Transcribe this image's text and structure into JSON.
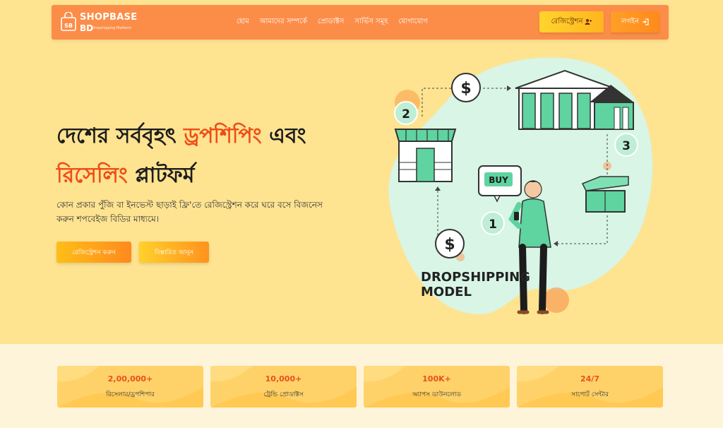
{
  "brand": {
    "name_line1": "SHOPBASE",
    "name_line2": "BD",
    "tagline": "Dropshipping Platform"
  },
  "nav": {
    "items": [
      "হোম",
      "আমাদের সম্পর্কে",
      "প্রোডাক্টস",
      "সার্ভিস সমূহ",
      "যোগাযোগ"
    ]
  },
  "header_actions": {
    "register_label": "রেজিস্ট্রেশন",
    "login_label": "লগইন"
  },
  "hero": {
    "headline_part1": "দেশের সর্ববৃহৎ ",
    "headline_accent1": "ড্রপশিপিং",
    "headline_part2": " এবং ",
    "headline_accent2": "রিসেলিং",
    "headline_part3": " প্লাটফর্ম",
    "subtext": "কোন প্রকার পুঁজি বা ইনভেস্ট ছাড়াই ফ্রি'তে রেজিস্ট্রেশন করে ঘরে বসে বিজনেস করুন শপবেইজ বিডির মাধ্যমে।",
    "cta_register": "রেজিস্ট্রেশন করুন",
    "cta_details": "বিস্তারিত জানুন"
  },
  "illustration": {
    "title_line1": "DROPSHIPPING",
    "title_line2": "MODEL",
    "buy_label": "BUY",
    "steps": [
      "1",
      "2",
      "3"
    ],
    "currency_symbol": "$"
  },
  "stats": [
    {
      "value": "2,00,000+",
      "label": "রিসেলার/ড্রপশিপার"
    },
    {
      "value": "10,000+",
      "label": "ট্রেন্ডি প্রোডাক্টস"
    },
    {
      "value": "100K+",
      "label": "অ্যাপস ডাউনলোড"
    },
    {
      "value": "24/7",
      "label": "সাপোর্ট সেন্টার"
    }
  ],
  "colors": {
    "nav_bg": "#fc8d48",
    "hero_bg": "#fee391",
    "accent": "#ef4d17",
    "stat_bg": "#ffd269",
    "mint": "#5fd3a0"
  }
}
